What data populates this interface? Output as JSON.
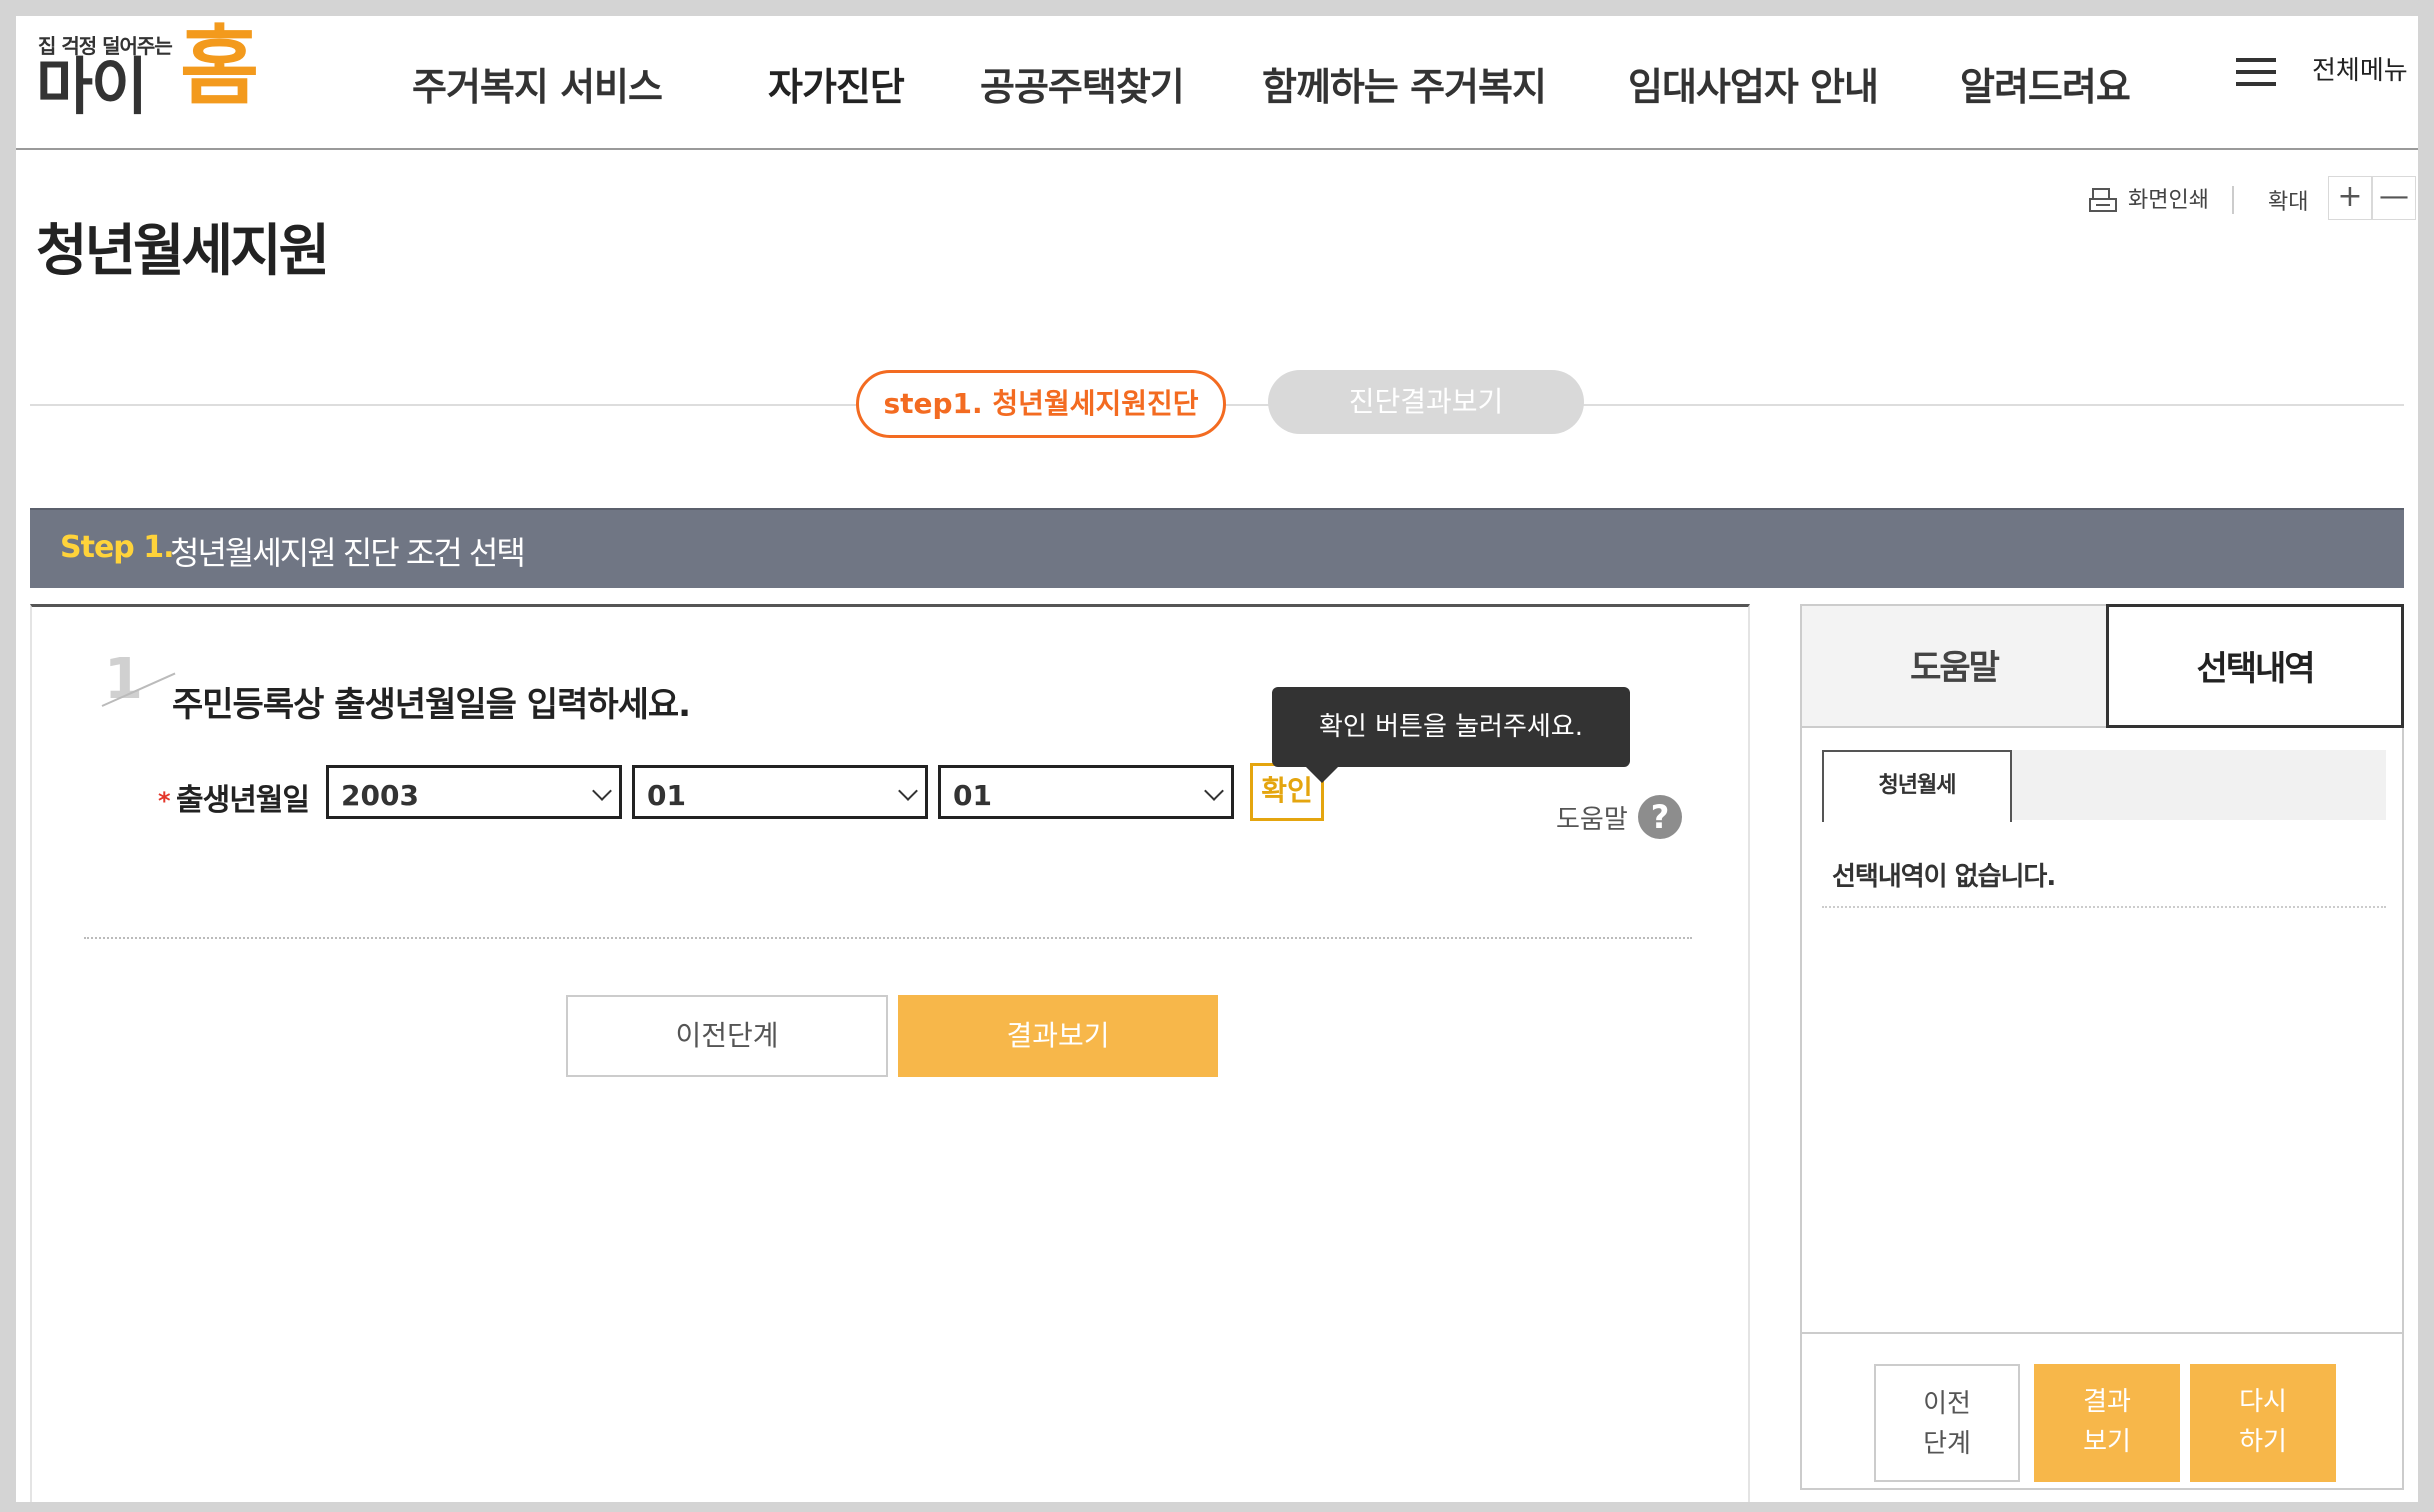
{
  "header": {
    "logo_tagline": "집 걱정 덜어주는",
    "logo_brand_a": "마이",
    "logo_brand_b": "홈",
    "nav": [
      {
        "label": "주거복지 서비스"
      },
      {
        "label": "자가진단"
      },
      {
        "label": "공공주택찾기"
      },
      {
        "label": "함께하는 주거복지"
      },
      {
        "label": "임대사업자 안내"
      },
      {
        "label": "알려드려요"
      }
    ],
    "active_nav": "자가진단",
    "all_menu": "전체메뉴"
  },
  "utility": {
    "print": "화면인쇄",
    "zoom": "확대",
    "zoom_in": "+",
    "zoom_out": "—"
  },
  "page_title": "청년월세지원",
  "steps": {
    "step1": "step1. 청년월세지원진단",
    "step2": "진단결과보기"
  },
  "section": {
    "label": "Step 1.",
    "title": "청년월세지원 진단 조건 선택"
  },
  "question": {
    "number": "1",
    "text": "주민등록상 출생년월일을 입력하세요.",
    "required_mark": "*",
    "field_label": "출생년월일",
    "year": "2003",
    "month": "01",
    "day": "01",
    "confirm": "확인",
    "tooltip": "확인 버튼을 눌러주세요.",
    "help": "도움말",
    "help_icon_glyph": "?"
  },
  "buttons": {
    "prev": "이전단계",
    "result": "결과보기"
  },
  "side": {
    "tab_help": "도움말",
    "tab_selection": "선택내역",
    "subtab": "청년월세",
    "empty": "선택내역이 없습니다.",
    "btn_prev_1": "이전",
    "btn_prev_2": "단계",
    "btn_result_1": "결과",
    "btn_result_2": "보기",
    "btn_again_1": "다시",
    "btn_again_2": "하기"
  },
  "colors": {
    "accent_orange": "#f36b21",
    "button_yellow": "#f7b74a",
    "nav_highlight": "#f7b928",
    "section_bar": "#707684",
    "section_label": "#ffd33a"
  }
}
